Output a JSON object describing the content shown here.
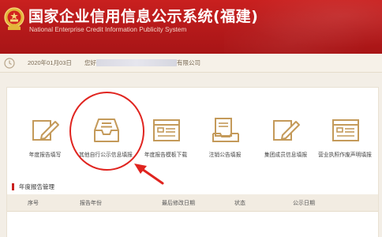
{
  "header": {
    "title_cn": "国家企业信用信息公示系统(福建)",
    "title_en": "National Enterprise Credit Information Publicity System",
    "brand_color": "#c9201f"
  },
  "infobar": {
    "date": "2020年01月03日",
    "user_prefix": "您好",
    "user_suffix": "有限公司"
  },
  "functions": [
    {
      "label": "年度报告填写",
      "icon": "pencil-edit-icon"
    },
    {
      "label": "其他自行公示信息填报",
      "icon": "inbox-tray-icon"
    },
    {
      "label": "年度报告模板下载",
      "icon": "form-window-icon"
    },
    {
      "label": "注销公告填报",
      "icon": "document-stack-icon"
    },
    {
      "label": "集团成员信息填报",
      "icon": "pencil-edit-icon"
    },
    {
      "label": "营业执照作废声明填报",
      "icon": "form-window-icon"
    }
  ],
  "report_section": {
    "title": "年度报告管理",
    "columns": [
      "序号",
      "报告年份",
      "最后修改日期",
      "状态",
      "公示日期"
    ]
  },
  "annotation": {
    "highlight_color": "#e0241f"
  }
}
